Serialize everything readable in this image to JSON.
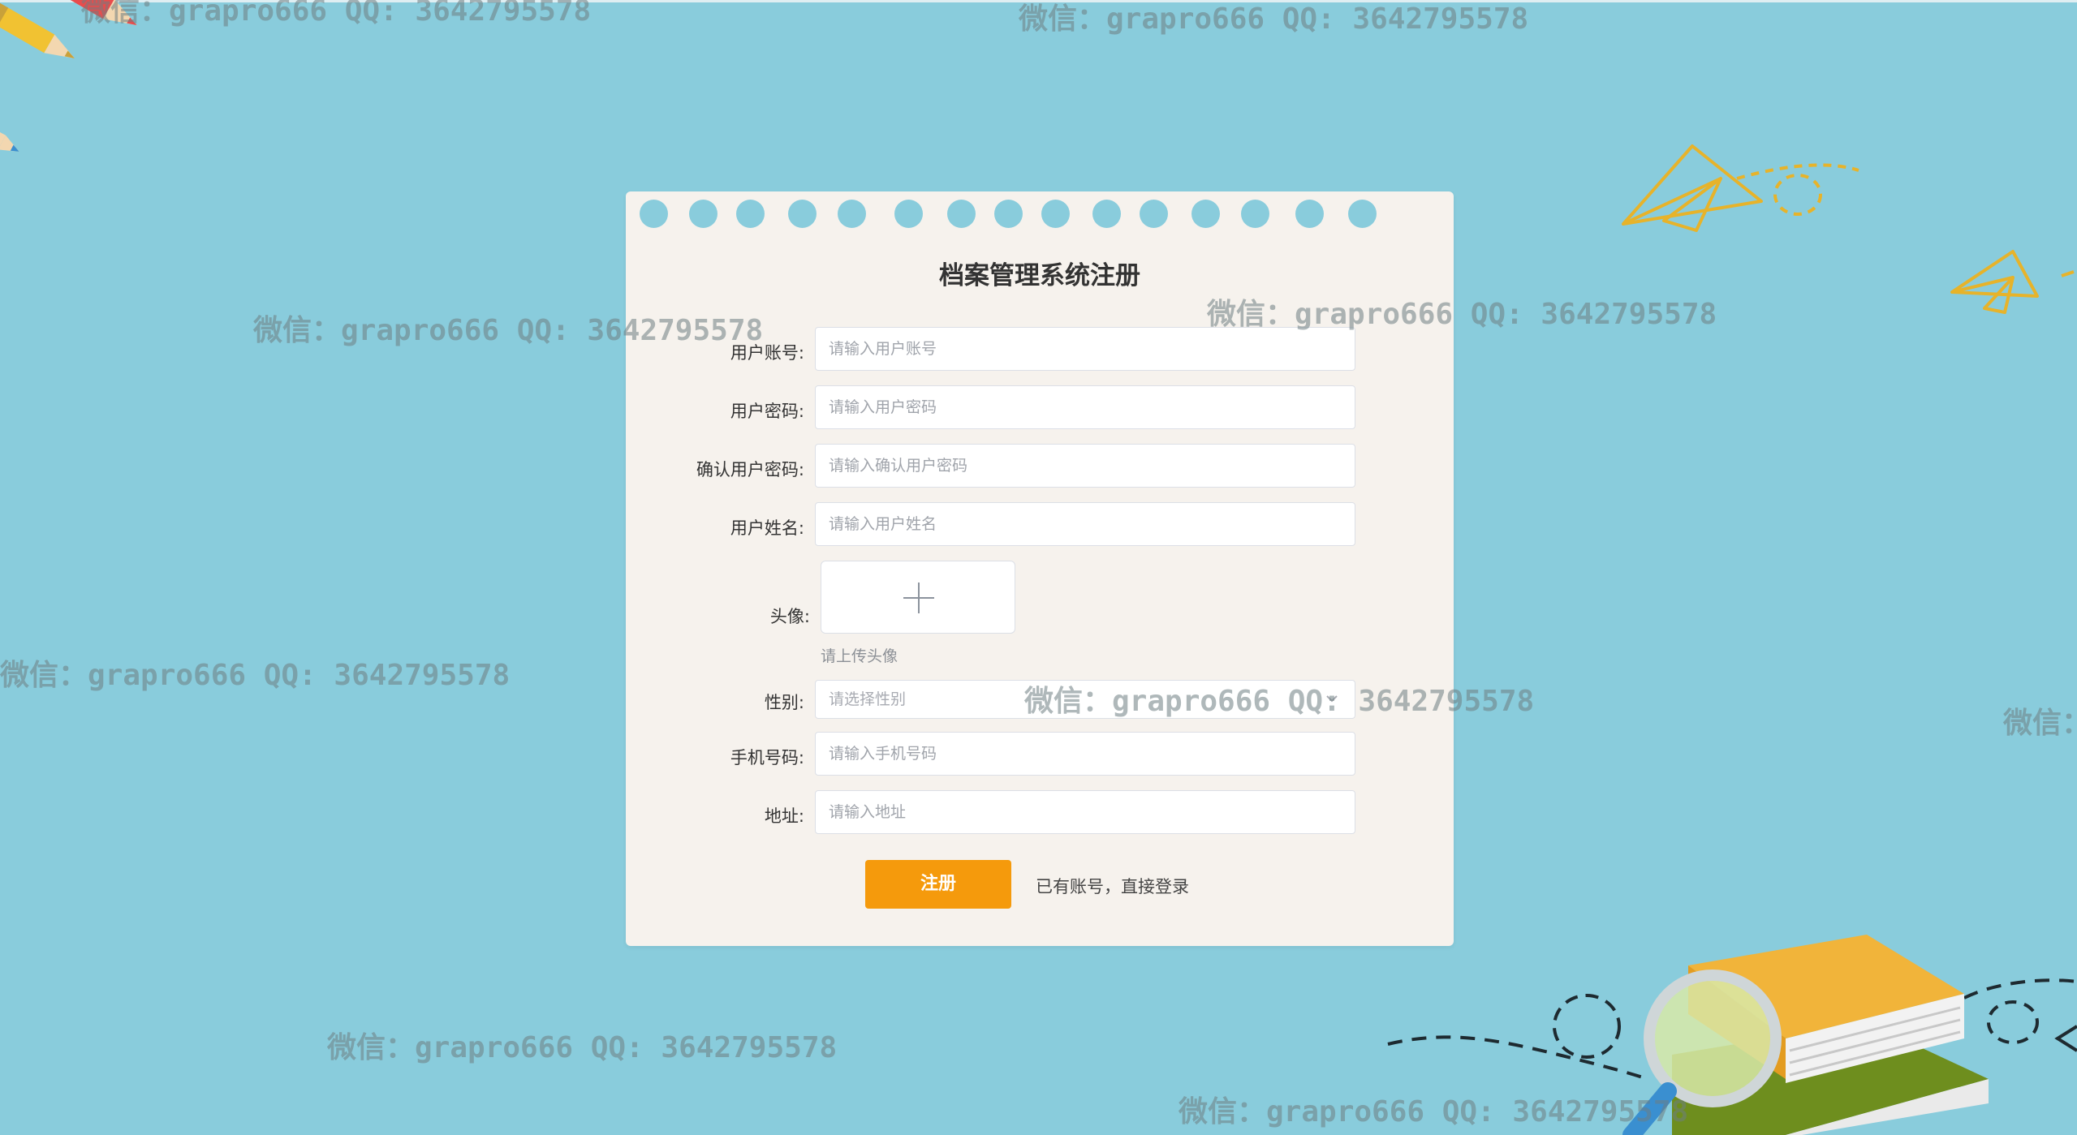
{
  "watermark_text": "微信：grapro666 QQ: 3642795578",
  "form": {
    "title": "档案管理系统注册",
    "fields": {
      "account": {
        "label": "用户账号:",
        "placeholder": "请输入用户账号"
      },
      "password": {
        "label": "用户密码:",
        "placeholder": "请输入用户密码"
      },
      "confirm_password": {
        "label": "确认用户密码:",
        "placeholder": "请输入确认用户密码"
      },
      "name": {
        "label": "用户姓名:",
        "placeholder": "请输入用户姓名"
      },
      "avatar": {
        "label": "头像:",
        "tip": "请上传头像"
      },
      "gender": {
        "label": "性别:",
        "placeholder": "请选择性别"
      },
      "phone": {
        "label": "手机号码:",
        "placeholder": "请输入手机号码"
      },
      "address": {
        "label": "地址:",
        "placeholder": "请输入地址"
      }
    },
    "register_button": "注册",
    "login_link": "已有账号，直接登录"
  },
  "colors": {
    "background": "#89ccdc",
    "card": "#f6f2ed",
    "button": "#f59a0c"
  },
  "icons": {
    "upload": "plus-icon",
    "select": "chevron-down-icon"
  }
}
